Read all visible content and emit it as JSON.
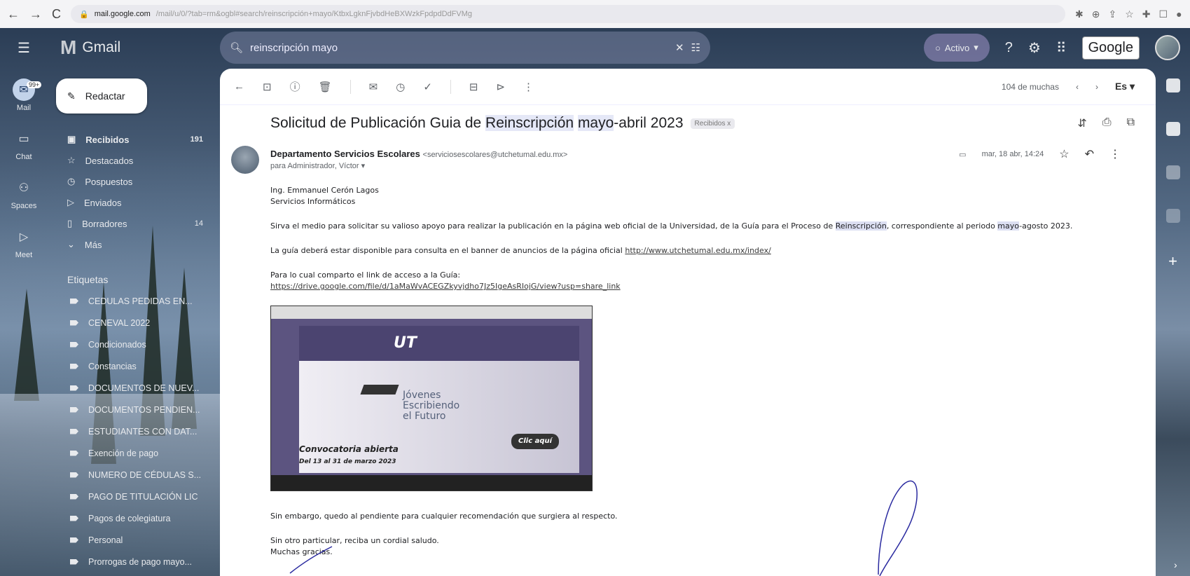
{
  "browser": {
    "url_host": "mail.google.com",
    "url_path": "/mail/u/0/?tab=rm&ogbl#search/reinscripción+mayo/KtbxLgknFjvbdHeBXWzkFpdpdDdFVMg"
  },
  "header": {
    "app_name": "Gmail",
    "search_query": "reinscripción mayo",
    "status": "Activo",
    "account_badge": "Google"
  },
  "rail": {
    "items": [
      {
        "label": "Mail",
        "badge": "99+"
      },
      {
        "label": "Chat"
      },
      {
        "label": "Spaces"
      },
      {
        "label": "Meet"
      }
    ]
  },
  "sidebar": {
    "compose": "Redactar",
    "folders": [
      {
        "label": "Recibidos",
        "count": "191"
      },
      {
        "label": "Destacados",
        "count": ""
      },
      {
        "label": "Pospuestos",
        "count": ""
      },
      {
        "label": "Enviados",
        "count": ""
      },
      {
        "label": "Borradores",
        "count": "14"
      },
      {
        "label": "Más",
        "count": ""
      }
    ],
    "labels_title": "Etiquetas",
    "labels": [
      "CEDULAS PEDIDAS EN...",
      "CENEVAL 2022",
      "Condicionados",
      "Constancias",
      "DOCUMENTOS DE NUEV...",
      "DOCUMENTOS PENDIEN...",
      "ESTUDIANTES CON DAT...",
      "Exención de pago",
      "NUMERO DE CÉDULAS S...",
      "PAGO DE TITULACIÓN LIC",
      "Pagos de colegiatura",
      "Personal",
      "Prorrogas de pago mayo..."
    ]
  },
  "toolbar": {
    "pagination": "104 de muchas",
    "language": "Es"
  },
  "email": {
    "subject_a": "Solicitud de Publicación Guia de ",
    "subject_hl1": "Reinscripción",
    "subject_b": " ",
    "subject_hl2": "mayo",
    "subject_c": "-abril 2023",
    "label_chip": "Recibidos x",
    "sender_name": "Departamento Servicios Escolares",
    "sender_email": "<serviciosescolares@utchetumal.edu.mx>",
    "to": "para Administrador, Víctor",
    "date": "mar, 18 abr, 14:24",
    "greeting_1": "Ing. Emmanuel Cerón Lagos",
    "greeting_2": "Servicios Informáticos",
    "para1_a": "Sirva el medio para solicitar su valioso apoyo para realizar la publicación en la página web oficial de la Universidad, de la Guía para el Proceso de ",
    "para1_hl1": "Reinscripción",
    "para1_b": ", correspondiente al periodo ",
    "para1_hl2": "mayo",
    "para1_c": "-agosto 2023.",
    "para2_a": "La guía deberá estar disponible para consulta en el banner de anuncios de la página oficial ",
    "para2_link": "http://www.utchetumal.edu.mx/index/",
    "para3": "Para lo cual comparto el link de acceso a la Guía:",
    "para3_link": "https://drive.google.com/file/d/1aMaWvACEGZkyvjdho7Jz5IgeAsRIojG/view?usp=share_link",
    "embed": {
      "logo": "UT",
      "hero_title_1": "Jóvenes",
      "hero_title_2": "Escribiendo",
      "hero_title_3": "el Futuro",
      "call": "Convocatoria abierta",
      "call_dates": "Del 13 al 31 de marzo 2023",
      "button": "Clic aquí"
    },
    "para4": "Sin embargo, quedo al pendiente para cualquier recomendación que surgiera al respecto.",
    "closing_1": "Sin otro particular, reciba un cordial saludo.",
    "closing_2": "Muchas gracias."
  }
}
